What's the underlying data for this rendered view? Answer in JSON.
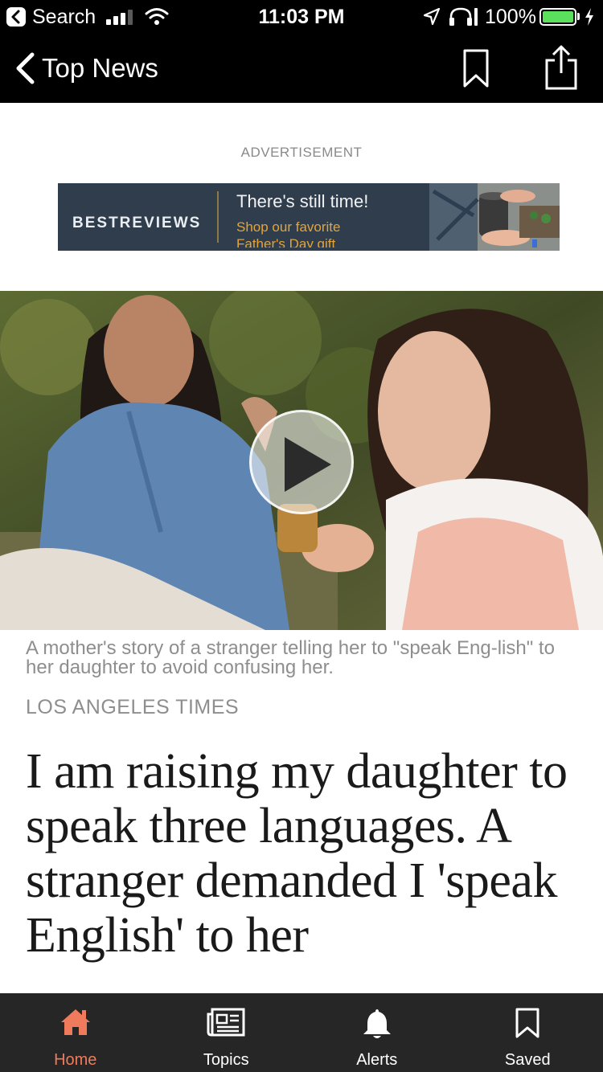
{
  "status_bar": {
    "back_app_label": "Search",
    "time": "11:03 PM",
    "battery_percent": "100%",
    "signal_bars": 3,
    "battery_level": 1.0
  },
  "nav": {
    "back_label": "Top News",
    "icons": [
      "chevron-left-icon",
      "bookmark-icon",
      "share-icon"
    ]
  },
  "ad": {
    "label": "ADVERTISEMENT",
    "brand": "BESTREVIEWS",
    "headline": "There's still time!",
    "subline": "Shop our favorite Father's Day gift"
  },
  "article": {
    "caption": "A mother's story of a stranger telling her to \"speak Eng-lish\" to her daughter to avoid confusing her.",
    "source": "LOS ANGELES TIMES",
    "headline": "I am raising my daughter to speak three languages. A stranger demanded I 'speak English' to her"
  },
  "tabs": [
    {
      "label": "Home",
      "icon": "home-icon",
      "active": true
    },
    {
      "label": "Topics",
      "icon": "newspaper-icon",
      "active": false
    },
    {
      "label": "Alerts",
      "icon": "bell-icon",
      "active": false
    },
    {
      "label": "Saved",
      "icon": "bookmark-icon",
      "active": false
    }
  ],
  "colors": {
    "accent": "#f07a5c",
    "bar_background": "#000000",
    "tab_bar_background": "#262626",
    "ad_background": "#2f3d4d",
    "ad_subline": "#e3a43a",
    "battery_fill": "#5ae05c"
  }
}
